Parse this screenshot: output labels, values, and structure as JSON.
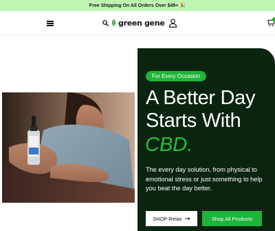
{
  "promo": {
    "text": "Free Shipping On All Orders Over $49+",
    "emoji": "🎉"
  },
  "header": {
    "logo_text": "green gene",
    "icons": [
      "menu-icon",
      "search-icon",
      "leaf-icon",
      "account-icon",
      "cart-icon"
    ]
  },
  "hero": {
    "badge": "For Every Occasion",
    "headline": "A Better Day Starts With",
    "headline_accent": "CBD.",
    "description": "The every day solution, from physical to emotional stress or just something to help you beat the day better.",
    "primary_button": "SHOP Relax",
    "secondary_button": "Shop All Products"
  },
  "colors": {
    "promo_bg": "#bff5b3",
    "panel_bg": "#0b2410",
    "accent_green": "#1fb43a",
    "headline_accent": "#1fc23a"
  }
}
